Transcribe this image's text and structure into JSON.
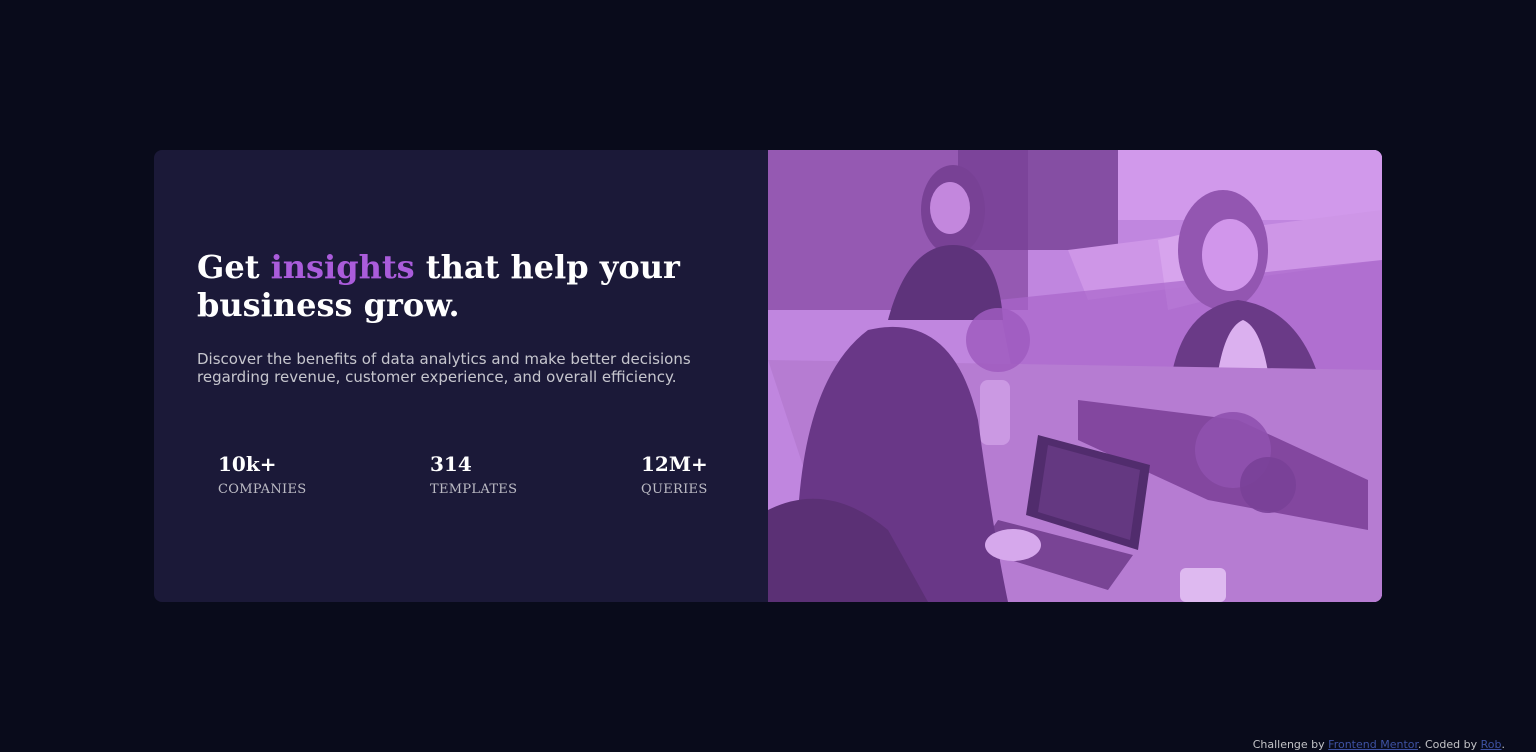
{
  "headline": {
    "before": "Get ",
    "accent": "insights",
    "after": " that help your business grow."
  },
  "description": "Discover the benefits of data analytics and make better decisions regarding revenue, customer experience, and overall efficiency.",
  "stats": [
    {
      "value": "10k+",
      "label": "COMPANIES"
    },
    {
      "value": "314",
      "label": "TEMPLATES"
    },
    {
      "value": "12M+",
      "label": "QUERIES"
    }
  ],
  "attribution": {
    "prefix": "Challenge by ",
    "challenge_link": "Frontend Mentor",
    "middle": ". Coded by ",
    "author_link": "Rob",
    "suffix": "."
  },
  "colors": {
    "page_background": "#090b1b",
    "card_background": "#1b1938",
    "accent": "#aa5cdb",
    "image_tint": "#aa5cdb",
    "link": "#3e52a3"
  }
}
